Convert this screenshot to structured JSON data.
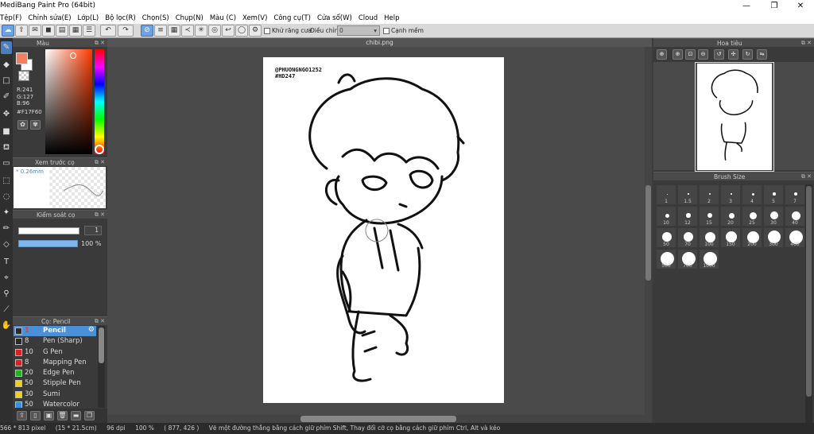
{
  "app": {
    "title": "MediBang Paint Pro (64bit)",
    "window_buttons": [
      "—",
      "❐",
      "✕"
    ]
  },
  "menu": [
    "Tệp(F)",
    "Chỉnh sửa(E)",
    "Lớp(L)",
    "Bộ lọc(R)",
    "Chọn(S)",
    "Chụp(N)",
    "Màu (C)",
    "Xem(V)",
    "Công cụ(T)",
    "Cửa sổ(W)",
    "Cloud",
    "Help"
  ],
  "toolbar": {
    "antialias_label": "Khử răng cưa",
    "adjust_label": "Điều chỉnh",
    "adjust_value": "0",
    "smooth_label": "Cạnh mềm"
  },
  "color_panel": {
    "title": "Màu",
    "rgb": "R:241\nG:127\nB:96",
    "r": "R:241",
    "g": "G:127",
    "b": "B:96",
    "hex": "#F17F60",
    "fg_color": "#F17F60"
  },
  "preview_panel": {
    "title": "Xem trước cọ",
    "size": "* 0.26mm"
  },
  "control_panel": {
    "title": "Kiểm soát cọ",
    "size_value": "1",
    "opacity_value": "100 %"
  },
  "brush_panel": {
    "title": "Cọ: Pencil",
    "brushes": [
      {
        "size": "1",
        "name": "Pencil",
        "color": "#2a2a2a"
      },
      {
        "size": "8",
        "name": "Pen (Sharp)",
        "color": "#2a2a2a"
      },
      {
        "size": "10",
        "name": "G Pen",
        "color": "#e02020"
      },
      {
        "size": "8",
        "name": "Mapping Pen",
        "color": "#e02020"
      },
      {
        "size": "20",
        "name": "Edge Pen",
        "color": "#20b020"
      },
      {
        "size": "50",
        "name": "Stipple Pen",
        "color": "#f0d020"
      },
      {
        "size": "30",
        "name": "Sumi",
        "color": "#f0d020"
      },
      {
        "size": "50",
        "name": "Watercolor",
        "color": "#3b8fd8"
      }
    ]
  },
  "canvas": {
    "tab": "chibi.png",
    "watermark1": "@PHUONGNGO1252",
    "watermark2": "#HD247"
  },
  "navigator": {
    "title": "Hoa tiêu"
  },
  "brush_size": {
    "title": "Brush Size",
    "sizes": [
      "1",
      "1.5",
      "2",
      "3",
      "4",
      "5",
      "7",
      "10",
      "12",
      "15",
      "20",
      "25",
      "30",
      "40",
      "50",
      "70",
      "100",
      "150",
      "200",
      "300",
      "400",
      "500",
      "700",
      "1000"
    ]
  },
  "status": {
    "dimensions": "566 * 813 pixel",
    "physical": "(15 * 21.5cm)",
    "dpi": "96 dpi",
    "zoom": "100 %",
    "coords": "( 877, 426 )",
    "hint": "Vẽ một đường thẳng bằng cách giữ phím Shift, Thay đổi cỡ cọ bằng cách giữ phím Ctrl, Alt và kéo"
  }
}
